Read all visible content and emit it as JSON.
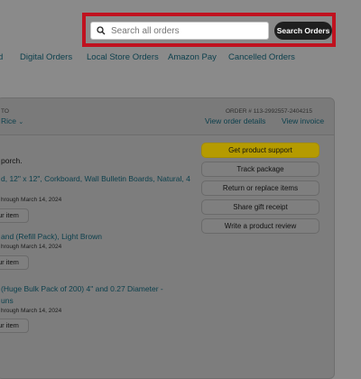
{
  "search": {
    "placeholder": "Search all orders",
    "button_label": "Search Orders"
  },
  "tabs": [
    {
      "label": "d"
    },
    {
      "label": "Digital Orders"
    },
    {
      "label": "Local Store Orders"
    },
    {
      "label": "Amazon Pay"
    },
    {
      "label": "Cancelled Orders"
    }
  ],
  "order": {
    "ship_to_label": "TO",
    "ship_to_name": "Rice",
    "order_number": "ORDER # 113-2992557-2404215",
    "view_details": "View order details",
    "view_invoice": "View invoice",
    "delivery_status": "porch."
  },
  "actions": [
    {
      "label": "Get product support"
    },
    {
      "label": "Track package"
    },
    {
      "label": "Return or replace items"
    },
    {
      "label": "Share gift receipt"
    },
    {
      "label": "Write a product review"
    }
  ],
  "items": [
    {
      "title_line1": "d, 12\" x 12\", Corkboard, Wall Bulletin Boards, Natural, 4",
      "title_line2": "",
      "return_text": "hrough March 14, 2024",
      "buy_label": "ur item"
    },
    {
      "title_line1": "and (Refill Pack), Light Brown",
      "title_line2": "",
      "return_text": "hrough March 14, 2024",
      "buy_label": "ur item"
    },
    {
      "title_line1": "(Huge Bulk Pack of 200) 4\" and 0.27 Diameter -",
      "title_line2": "uns",
      "return_text": "hrough March 14, 2024",
      "buy_label": "ur item"
    }
  ]
}
